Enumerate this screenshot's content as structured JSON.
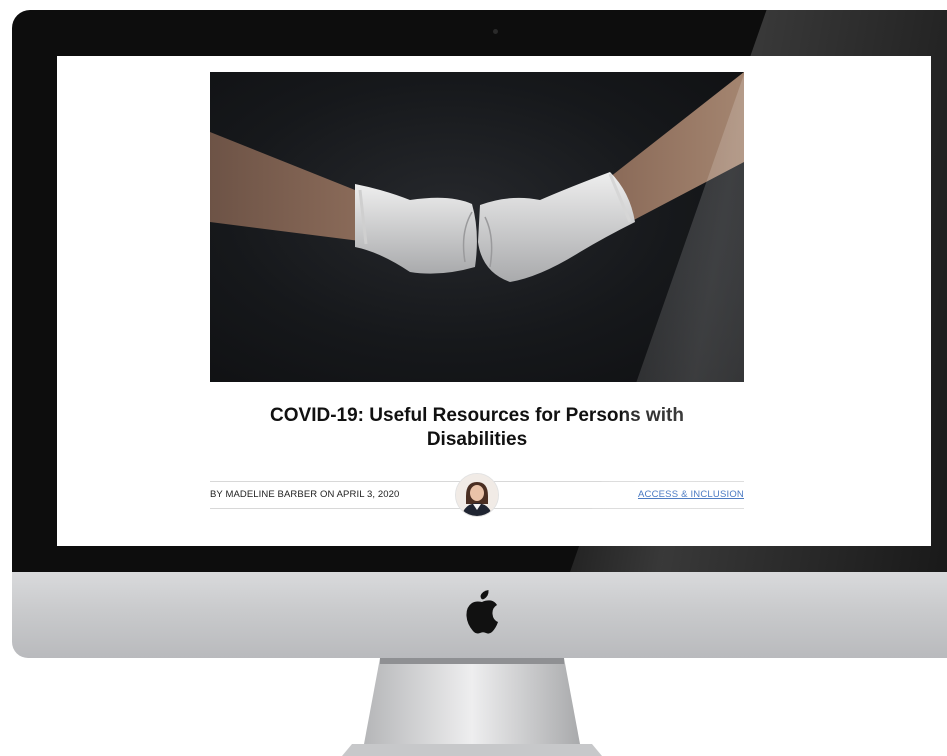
{
  "device": {
    "logo_icon": "apple-logo-icon"
  },
  "article": {
    "hero_image": "gloved-fist-bump-photo",
    "title_line1": "COVID-19: Useful Resources for Persons with",
    "title_line2": "Disabilities",
    "byline": "BY MADELINE BARBER ON APRIL 3, 2020",
    "category": "ACCESS & INCLUSION",
    "author_avatar": "author-avatar"
  },
  "colors": {
    "link": "#2a62b8",
    "bezel": "#0d0d0d",
    "chin": "#c9cacc"
  }
}
